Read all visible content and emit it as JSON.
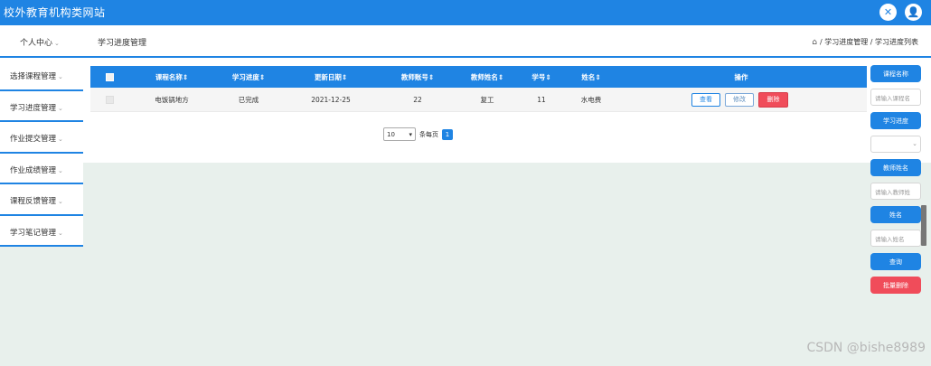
{
  "app": {
    "title": "校外教育机构类网站"
  },
  "header": {
    "personal_center": "个人中心",
    "page_title": "学习进度管理",
    "breadcrumb": "/ 学习进度管理 / 学习进度列表",
    "icons": [
      "expand-icon",
      "user-icon"
    ]
  },
  "sidebar": {
    "items": [
      {
        "label": "选择课程管理"
      },
      {
        "label": "学习进度管理"
      },
      {
        "label": "作业提交管理"
      },
      {
        "label": "作业成绩管理"
      },
      {
        "label": "课程反馈管理"
      },
      {
        "label": "学习笔记管理"
      }
    ]
  },
  "table": {
    "columns": [
      "课程名称",
      "学习进度",
      "更新日期",
      "教师账号",
      "教师姓名",
      "学号",
      "姓名",
      "操作"
    ],
    "rows": [
      {
        "course": "电饭锅地方",
        "progress": "已完成",
        "date": "2021-12-25",
        "teacher_account": "22",
        "teacher_name": "复工",
        "student_no": "11",
        "name": "水电费",
        "view": "查看",
        "edit": "修改",
        "delete": "删除"
      }
    ]
  },
  "pager": {
    "page_size": "10",
    "per_page_label": "条每页",
    "current_page": "1"
  },
  "filter": {
    "course_label": "课程名称",
    "course_placeholder": "请输入课程名",
    "progress_label": "学习进度",
    "teacher_label": "教师姓名",
    "teacher_placeholder": "请输入教师姓",
    "name_label": "姓名",
    "name_placeholder": "请输入姓名",
    "search": "查询",
    "batch_delete": "批量删除"
  },
  "watermark": "CSDN @bishe8989",
  "colors": {
    "primary": "#1f84e3",
    "danger": "#f04c5a",
    "background_lower": "#e8f0ec"
  }
}
